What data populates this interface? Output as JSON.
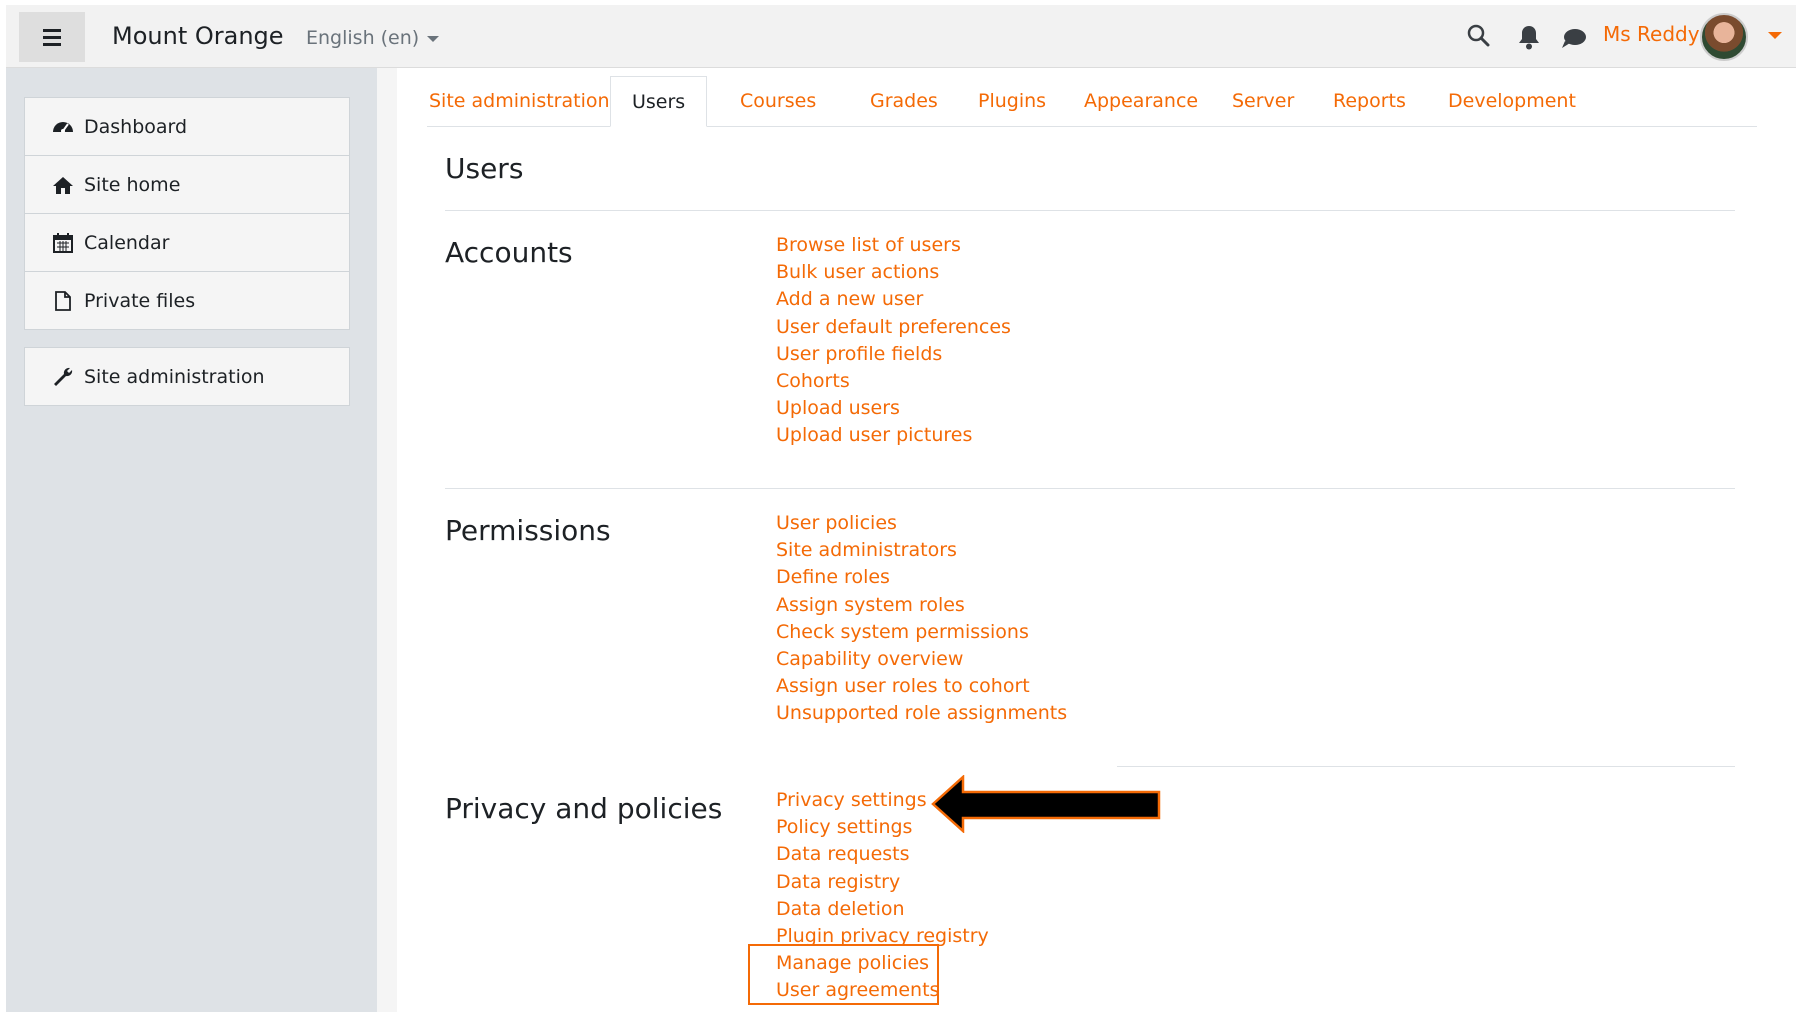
{
  "navbar": {
    "site_name": "Mount Orange",
    "language": "English (en)",
    "user_name": "Ms Reddy",
    "icons": [
      "hamburger-icon",
      "search-icon",
      "bell-icon",
      "chat-icon",
      "avatar",
      "caret-down-icon"
    ]
  },
  "sidebar": {
    "items": [
      {
        "label": "Dashboard",
        "icon": "dashboard-icon"
      },
      {
        "label": "Site home",
        "icon": "home-icon"
      },
      {
        "label": "Calendar",
        "icon": "calendar-icon"
      },
      {
        "label": "Private files",
        "icon": "file-icon"
      }
    ],
    "admin_item": {
      "label": "Site administration",
      "icon": "wrench-icon"
    }
  },
  "tabs": [
    {
      "label": "Site administration"
    },
    {
      "label": "Users",
      "active": true
    },
    {
      "label": "Courses"
    },
    {
      "label": "Grades"
    },
    {
      "label": "Plugins"
    },
    {
      "label": "Appearance"
    },
    {
      "label": "Server"
    },
    {
      "label": "Reports"
    },
    {
      "label": "Development"
    }
  ],
  "page": {
    "heading": "Users",
    "sections": [
      {
        "title": "Accounts",
        "links": [
          "Browse list of users",
          "Bulk user actions",
          "Add a new user",
          "User default preferences",
          "User profile fields",
          "Cohorts",
          "Upload users",
          "Upload user pictures"
        ]
      },
      {
        "title": "Permissions",
        "links": [
          "User policies",
          "Site administrators",
          "Define roles",
          "Assign system roles",
          "Check system permissions",
          "Capability overview",
          "Assign user roles to cohort",
          "Unsupported role assignments"
        ]
      },
      {
        "title": "Privacy and policies",
        "links": [
          "Privacy settings",
          "Policy settings",
          "Data requests",
          "Data registry",
          "Data deletion",
          "Plugin privacy registry",
          "Manage policies",
          "User agreements"
        ]
      }
    ]
  },
  "colors": {
    "accent": "#f46a06",
    "text": "#1d2125",
    "drawer_bg": "#dee2e6",
    "arrow": "#000000"
  }
}
